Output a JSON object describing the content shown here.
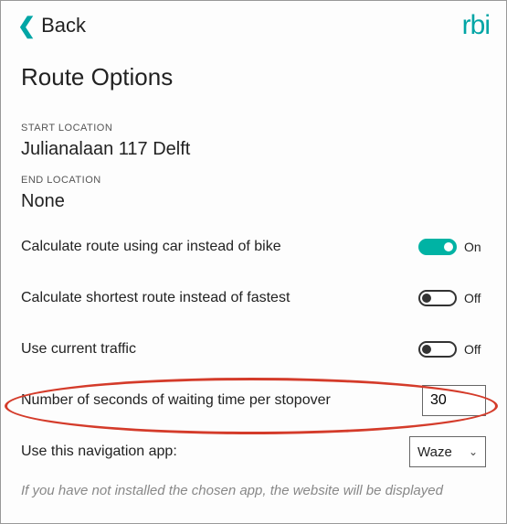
{
  "header": {
    "back_label": "Back",
    "logo": "rbi"
  },
  "title": "Route Options",
  "start": {
    "label": "START LOCATION",
    "value": "Julianalaan 117 Delft"
  },
  "end": {
    "label": "END LOCATION",
    "value": "None"
  },
  "opts": {
    "car": {
      "label": "Calculate route using car instead of bike",
      "state": "On"
    },
    "shortest": {
      "label": "Calculate shortest route instead of fastest",
      "state": "Off"
    },
    "traffic": {
      "label": "Use current traffic",
      "state": "Off"
    },
    "waiting": {
      "label": "Number of seconds of waiting time per stopover",
      "value": "30"
    },
    "navapp": {
      "label": "Use this navigation app:",
      "value": "Waze"
    }
  },
  "hint": "If you have not installed the chosen app, the website will be displayed"
}
